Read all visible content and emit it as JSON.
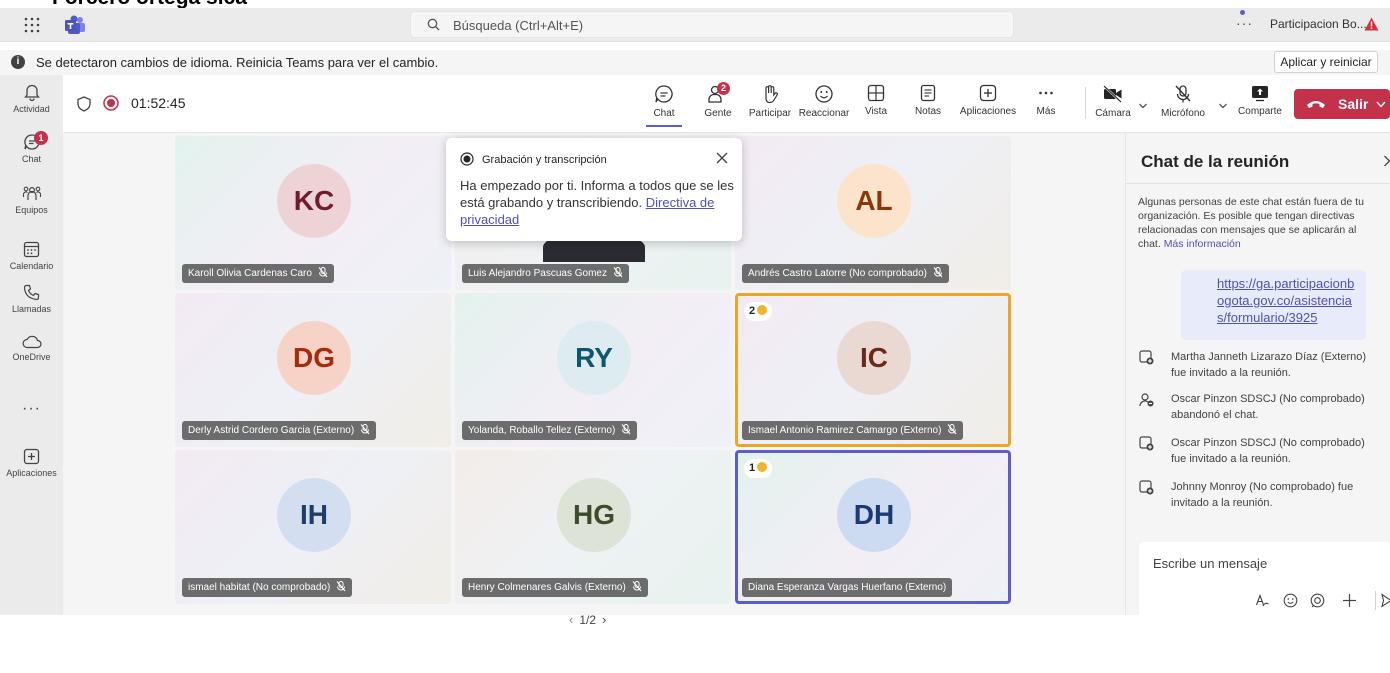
{
  "top_strip_text": "Forcero ortega sica",
  "titlebar": {
    "search_placeholder": "Búsqueda (Ctrl+Alt+E)",
    "more": "···",
    "account_name": "Participacion Bo..."
  },
  "notification": {
    "text": "Se detectaron cambios de idioma. Reinicia Teams para ver el cambio.",
    "apply_label": "Aplicar y reiniciar"
  },
  "rail": {
    "items": [
      {
        "label": "Actividad",
        "icon": "bell-icon"
      },
      {
        "label": "Chat",
        "icon": "chat-icon",
        "badge": "1"
      },
      {
        "label": "Equipos",
        "icon": "teams-people-icon"
      },
      {
        "label": "Calendario",
        "icon": "calendar-icon"
      },
      {
        "label": "Llamadas",
        "icon": "phone-icon"
      },
      {
        "label": "OneDrive",
        "icon": "cloud-icon"
      },
      {
        "label": "Aplicaciones",
        "icon": "add-apps-icon"
      }
    ],
    "more": "···"
  },
  "meeting_toolbar": {
    "timer": "01:52:45",
    "buttons": [
      {
        "label": "Chat",
        "icon": "chat-icon",
        "active": true
      },
      {
        "label": "Gente",
        "icon": "people-icon",
        "badge": "2"
      },
      {
        "label": "Participar",
        "icon": "raise-hand-icon"
      },
      {
        "label": "Reaccionar",
        "icon": "smiley-icon"
      },
      {
        "label": "Vista",
        "icon": "grid-view-icon"
      },
      {
        "label": "Notas",
        "icon": "notes-icon"
      },
      {
        "label": "Aplicaciones",
        "icon": "add-icon"
      },
      {
        "label": "Más",
        "icon": "more-icon"
      }
    ],
    "devices": [
      {
        "label": "Cámara",
        "icon": "camera-off-icon"
      },
      {
        "label": "Micrófono",
        "icon": "mic-off-icon"
      },
      {
        "label": "Comparte",
        "icon": "share-icon"
      }
    ],
    "leave_label": "Salir"
  },
  "recording_popup": {
    "title": "Grabación y transcripción",
    "body": "Ha empezado por ti. Informa a todos que se les está grabando y transcribiendo.",
    "link": "Directiva de privacidad"
  },
  "participants": [
    {
      "initials": "KC",
      "name": "Karoll Olivia Cardenas Caro",
      "avatar_bg": "#eed3d6",
      "avatar_fg": "#6f1c2c",
      "muted": true
    },
    {
      "initials": "",
      "name": "Luis Alejandro Pascuas Gomez",
      "avatar_bg": "",
      "avatar_fg": "",
      "muted": true
    },
    {
      "initials": "AL",
      "name": "Andrés Castro Latorre (No comprobado)",
      "avatar_bg": "#fbe3cc",
      "avatar_fg": "#8a3707",
      "muted": true
    },
    {
      "initials": "DG",
      "name": "Derly Astrid Cordero Garcia (Externo)",
      "avatar_bg": "#f6d3c6",
      "avatar_fg": "#a52a0e",
      "muted": true
    },
    {
      "initials": "RY",
      "name": "Yolanda, Roballo Tellez (Externo)",
      "avatar_bg": "#dcecf1",
      "avatar_fg": "#0e5571",
      "muted": true
    },
    {
      "initials": "IC",
      "name": "Ismael Antonio Ramirez Camargo (Externo)",
      "avatar_bg": "#ead9d2",
      "avatar_fg": "#6b2a18",
      "muted": true,
      "hand": "2"
    },
    {
      "initials": "IH",
      "name": "ismael habitat (No comprobado)",
      "avatar_bg": "#d3dff0",
      "avatar_fg": "#1f3d6a",
      "muted": true
    },
    {
      "initials": "HG",
      "name": "Henry Colmenares Galvis (Externo)",
      "avatar_bg": "#dde3d6",
      "avatar_fg": "#3d4a2c",
      "muted": true
    },
    {
      "initials": "DH",
      "name": "Diana Esperanza Vargas Huerfano (Externo)",
      "avatar_bg": "#cddbf2",
      "avatar_fg": "#1b3a73",
      "muted": false,
      "hand": "1"
    }
  ],
  "pager": {
    "text": "1/2"
  },
  "chat_panel": {
    "title": "Chat de la reunión",
    "notice": "Algunas personas de este chat están fuera de tu organización. Es posible que tengan directivas relacionadas con mensajes que se aplicarán al chat.",
    "notice_link": "Más información",
    "message_link": "https://ga.participacionbogota.gov.co/asistencias/formulario/3925",
    "events": [
      {
        "icon": "invite-icon",
        "text": "Martha Janneth Lizarazo Díaz (Externo) fue invitado a la reunión."
      },
      {
        "icon": "left-chat-icon",
        "text": "Oscar Pinzon SDSCJ (No comprobado) abandonó el chat."
      },
      {
        "icon": "invite-icon",
        "text": "Oscar Pinzon SDSCJ (No comprobado) fue invitado a la reunión."
      },
      {
        "icon": "invite-icon",
        "text": "Johnny Monroy (No comprobado) fue invitado a la reunión."
      }
    ],
    "compose_placeholder": "Escribe un mensaje"
  },
  "colors": {
    "accent": "#5b5fc7",
    "leave_red": "#c4314b",
    "hand_border": "#e9a628"
  }
}
